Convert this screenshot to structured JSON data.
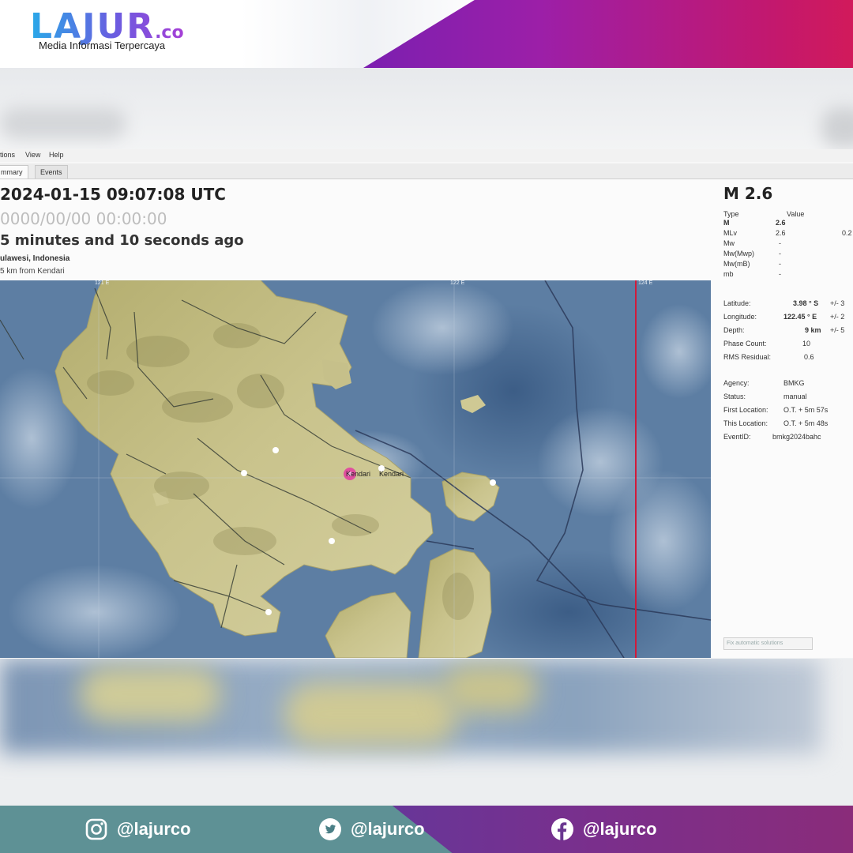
{
  "brand": {
    "logo": "LAJUR",
    "logo_suffix": ".co",
    "tagline": "Media Informasi Terpercaya",
    "colors": {
      "primary_purple": "#7b1fb0",
      "accent_pink": "#d41a57",
      "logo_blue": "#29a9e8"
    }
  },
  "app": {
    "menu": [
      "tions",
      "View",
      "Help"
    ],
    "tabs": [
      "mmary",
      "Events"
    ],
    "active_tab": "mmary"
  },
  "event": {
    "origin_time": "2024-01-15 09:07:08 UTC",
    "secondary_time": "0000/00/00  00:00:00",
    "time_ago": "5 minutes and 10 seconds ago",
    "region": "ulawesi, Indonesia",
    "distance": "5 km from Kendari"
  },
  "map": {
    "city_label": "Kendari",
    "epicenter_label": "Kendari",
    "lon_ticks": [
      "121 E",
      "122 E",
      "124 E"
    ],
    "colors": {
      "sea": "#5d7ea3",
      "land": "#c4bf86",
      "boundary": "#d11a3a"
    }
  },
  "magnitude": {
    "title": "M 2.6",
    "header": {
      "type": "Type",
      "value": "Value"
    },
    "rows": [
      {
        "type": "M",
        "value": "2.6"
      },
      {
        "type": "MLv",
        "value": "2.6"
      },
      {
        "type": "Mw",
        "value": "-"
      },
      {
        "type": "Mw(Mwp)",
        "value": "-"
      },
      {
        "type": "Mw(mB)",
        "value": "-"
      },
      {
        "type": "mb",
        "value": "-"
      }
    ],
    "extra": "0.2"
  },
  "location": {
    "latitude_label": "Latitude:",
    "latitude_value": "3.98 ° S",
    "latitude_err": "+/-  3",
    "longitude_label": "Longitude:",
    "longitude_value": "122.45 ° E",
    "longitude_err": "+/-  2",
    "depth_label": "Depth:",
    "depth_value": "9 km",
    "depth_err": "+/-  5",
    "phase_label": "Phase Count:",
    "phase_value": "10",
    "rms_label": "RMS Residual:",
    "rms_value": "0.6"
  },
  "origin_info": {
    "agency_label": "Agency:",
    "agency_value": "BMKG",
    "status_label": "Status:",
    "status_value": "manual",
    "first_label": "First Location:",
    "first_value": "O.T. + 5m 57s",
    "this_label": "This Location:",
    "this_value": "O.T. + 5m 48s",
    "eventid_label": "EventID:",
    "eventid_value": "bmkg2024bahc",
    "auto_button": "Fix automatic solutions"
  },
  "footer": {
    "instagram": "@lajurco",
    "twitter": "@lajurco",
    "facebook": "@lajurco"
  }
}
